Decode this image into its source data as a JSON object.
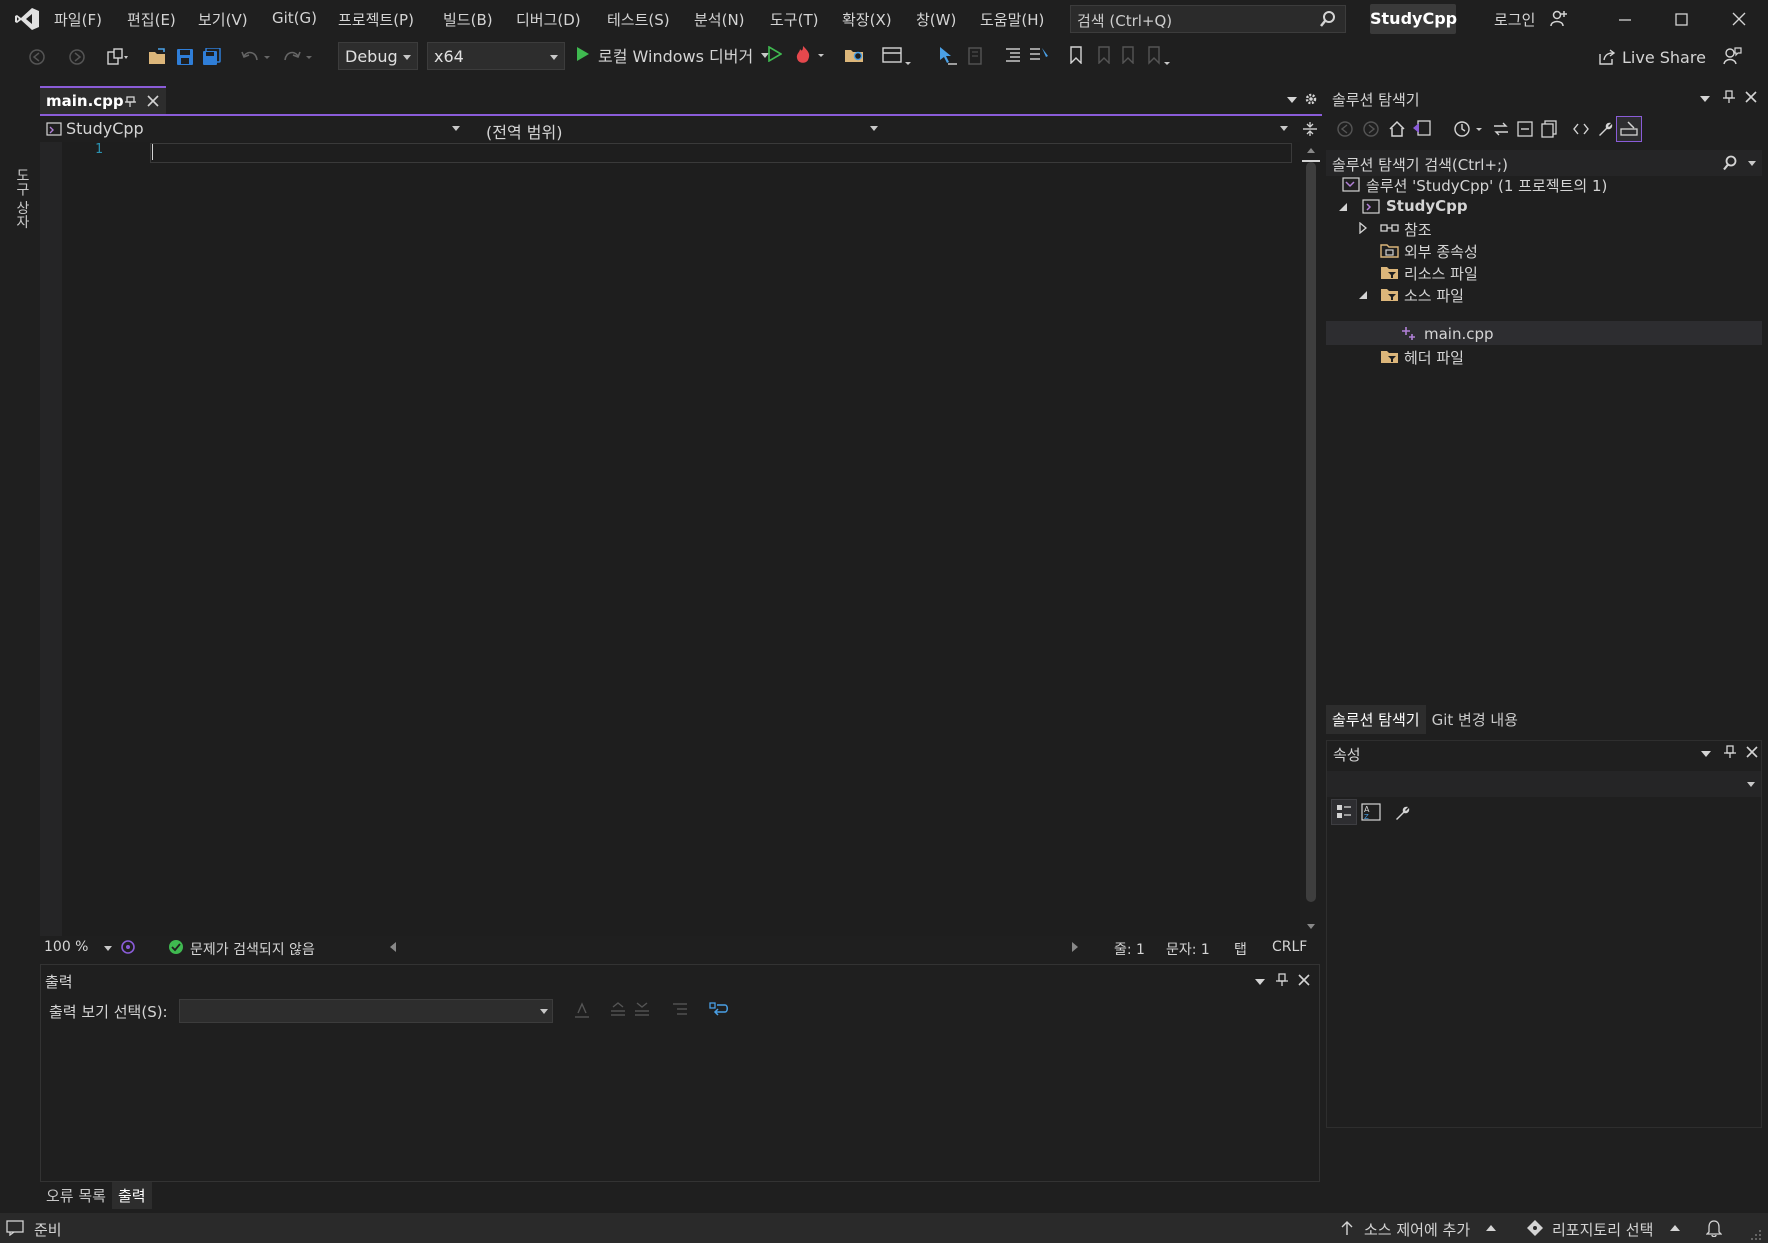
{
  "menu": {
    "items": [
      "파일(F)",
      "편집(E)",
      "보기(V)",
      "Git(G)",
      "프로젝트(P)",
      "빌드(B)",
      "디버그(D)",
      "테스트(S)",
      "분석(N)",
      "도구(T)",
      "확장(X)",
      "창(W)",
      "도움말(H)"
    ],
    "search_placeholder": "검색 (Ctrl+Q)",
    "solution_badge": "StudyCpp",
    "login": "로그인"
  },
  "toolbar": {
    "config": "Debug",
    "platform": "x64",
    "run_label": "로컬 Windows 디버거",
    "live_share": "Live Share"
  },
  "left_rail": {
    "label": "도구 상자"
  },
  "editor": {
    "tab_label": "main.cpp",
    "nav_project": "StudyCpp",
    "nav_scope": "(전역 범위)",
    "line_number": "1",
    "zoom": "100 %",
    "issues": "문제가 검색되지 않음",
    "line": "줄: 1",
    "col": "문자: 1",
    "indent": "탭",
    "eol": "CRLF"
  },
  "output": {
    "title": "출력",
    "show_label": "출력 보기 선택(S):"
  },
  "bottom_tabs": {
    "errors": "오류 목록",
    "output": "출력"
  },
  "solution_explorer": {
    "title": "솔루션 탐색기",
    "search": "솔루션 탐색기 검색(Ctrl+;)",
    "tree": {
      "solution": "솔루션 'StudyCpp' (1 프로젝트의 1)",
      "project": "StudyCpp",
      "references": "참조",
      "external": "외부 종속성",
      "resources": "리소스 파일",
      "sources": "소스 파일",
      "main_cpp": "main.cpp",
      "headers": "헤더 파일"
    },
    "tab_solution": "솔루션 탐색기",
    "tab_git": "Git 변경 내용"
  },
  "properties": {
    "title": "속성"
  },
  "statusbar": {
    "ready": "준비",
    "source_control": "소스 제어에 추가",
    "repo": "리포지토리 선택"
  },
  "colors": {
    "accent": "#8a5cd8",
    "run_green": "#3fb950",
    "folder": "#dcb67a",
    "line_number": "#2b91af"
  }
}
